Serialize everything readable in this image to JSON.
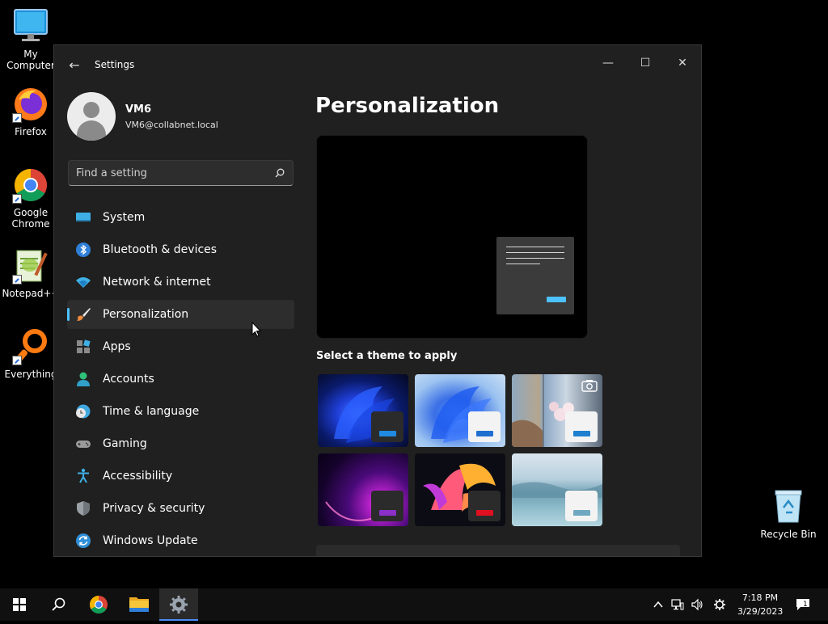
{
  "desktop": {
    "icons": [
      {
        "label": "My Computer"
      },
      {
        "label": "Firefox"
      },
      {
        "label": "Google Chrome"
      },
      {
        "label": "Notepad++"
      },
      {
        "label": "Everything"
      },
      {
        "label": "Recycle Bin"
      }
    ]
  },
  "window": {
    "title": "Settings",
    "minimize_glyph": "—",
    "maximize_glyph": "☐",
    "close_glyph": "✕",
    "back_glyph": "←"
  },
  "profile": {
    "name": "VM6",
    "email": "VM6@collabnet.local"
  },
  "search": {
    "placeholder": "Find a setting"
  },
  "nav": {
    "items": [
      {
        "label": "System",
        "icon": "system-icon"
      },
      {
        "label": "Bluetooth & devices",
        "icon": "bluetooth-icon"
      },
      {
        "label": "Network & internet",
        "icon": "network-icon"
      },
      {
        "label": "Personalization",
        "icon": "brush-icon",
        "selected": true
      },
      {
        "label": "Apps",
        "icon": "apps-icon"
      },
      {
        "label": "Accounts",
        "icon": "accounts-icon"
      },
      {
        "label": "Time & language",
        "icon": "clock-globe-icon"
      },
      {
        "label": "Gaming",
        "icon": "gamepad-icon"
      },
      {
        "label": "Accessibility",
        "icon": "accessibility-icon"
      },
      {
        "label": "Privacy & security",
        "icon": "shield-icon"
      },
      {
        "label": "Windows Update",
        "icon": "update-icon"
      }
    ]
  },
  "content": {
    "title": "Personalization",
    "theme_heading": "Select a theme to apply"
  },
  "taskbar": {
    "clock_time": "7:18 PM",
    "clock_date": "3/29/2023",
    "notification_count": "1"
  },
  "colors": {
    "accent": "#4cc2ff",
    "window_bg": "#202020",
    "selected_bg": "#2d2d2d"
  }
}
